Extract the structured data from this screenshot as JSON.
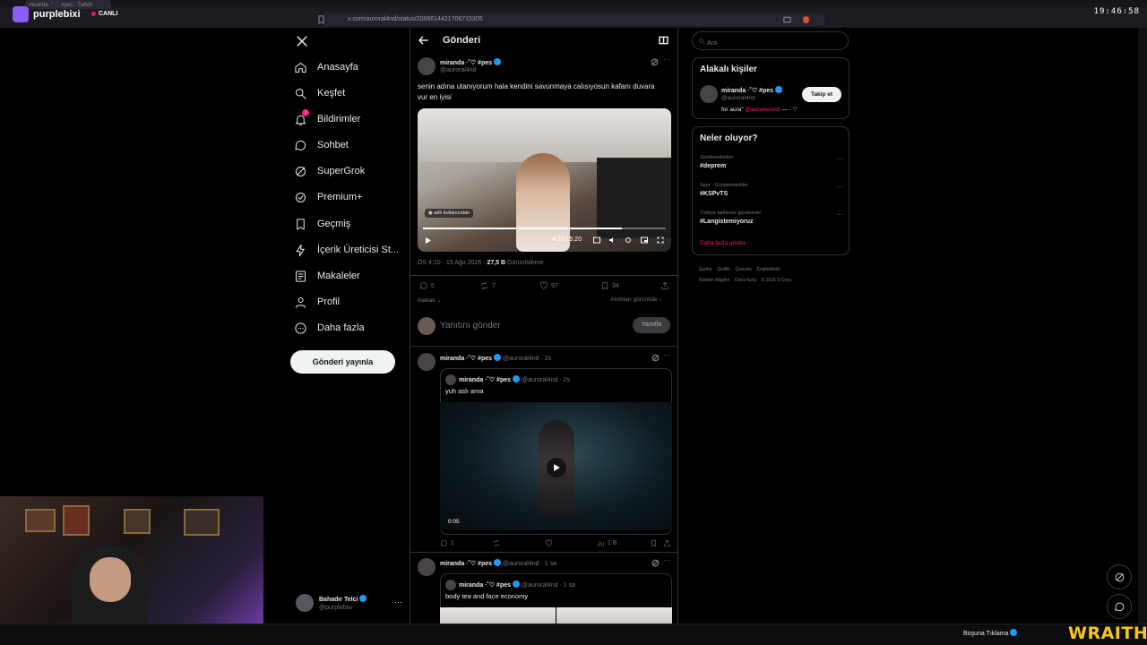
{
  "browser": {
    "tab_title": "miranda ·˚ ♡ #pes - Twitch",
    "brand": "purplebixi",
    "live_label": "CANLI",
    "url": "x.com/auroral4nd/status/2088614421706715305",
    "clock": "19:46:58"
  },
  "nav": {
    "items": [
      {
        "label": "Anasayfa",
        "icon": "home-icon"
      },
      {
        "label": "Keşfet",
        "icon": "search-icon"
      },
      {
        "label": "Bildirimler",
        "icon": "bell-icon",
        "badge": "1"
      },
      {
        "label": "Sohbet",
        "icon": "chat-icon"
      },
      {
        "label": "SuperGrok",
        "icon": "grok-icon"
      },
      {
        "label": "Premium+",
        "icon": "verified-icon"
      },
      {
        "label": "Geçmiş",
        "icon": "bookmark-icon"
      },
      {
        "label": "İçerik Üreticisi St...",
        "icon": "lightning-icon"
      },
      {
        "label": "Makaleler",
        "icon": "article-icon"
      },
      {
        "label": "Profil",
        "icon": "person-icon"
      },
      {
        "label": "Daha fazla",
        "icon": "more-circle-icon"
      }
    ],
    "post_button": "Gönderi yayınla",
    "account": {
      "name": "Bahadır Telci",
      "handle": "@purplebixi"
    }
  },
  "main": {
    "header_title": "Gönderi",
    "tweet": {
      "name": "miranda ·˚♡ #pes",
      "handle": "@auroral4nd",
      "text": "senin adına utanıyorum hala kendini savunmaya calısıyosun kafanı duvara vur en iyisi",
      "video_label": "adlı kullanıcıdan",
      "video_time": "4:25 / 5:20",
      "video_progress": 0.82,
      "time": "ÖS 4:10 · 15 Ağu 2026 ·",
      "views_count": "27,5 B",
      "views_label": "Görüntüleme",
      "replies": "5",
      "retweets": "7",
      "likes": "97",
      "bookmarks": "34",
      "related_label": "Alakalı",
      "quotes_label": "Alıntıları görüntüle"
    },
    "reply_box": {
      "placeholder": "Yanıtını gönder",
      "button": "Yanıtla"
    },
    "replies": [
      {
        "name": "miranda ·˚♡ #pes",
        "handle": "@auroral4nd · 2s",
        "quote": {
          "name": "miranda ·˚♡ #pes",
          "handle": "@auroral4nd · 2s",
          "text": "yuh aslı ama",
          "video_time": "0:05"
        },
        "replies": "1",
        "views": "1 B"
      },
      {
        "name": "miranda ·˚♡ #pes",
        "handle": "@auroral4nd · 1 sa",
        "quote": {
          "name": "miranda ·˚♡ #pes",
          "handle": "@auroral4nd · 1 sa",
          "text": "body tea and face economy"
        }
      }
    ]
  },
  "right": {
    "search_placeholder": "Ara",
    "related": {
      "title": "Alakalı kişiler",
      "name": "miranda ·˚♡ #pes",
      "handle": "@auroral4nd",
      "bio_prefix": "for aura\"",
      "bio_mention": "@aura4world",
      "bio_suffix": "— · ♡",
      "follow": "Takip et"
    },
    "trends": {
      "title": "Neler oluyor?",
      "items": [
        {
          "category": "Gündemdekiler",
          "tag": "#deprem"
        },
        {
          "category": "Spor · Gündemdekiler",
          "tag": "#KSPvTS"
        },
        {
          "category": "Türkiye tarihinde gündemde",
          "tag": "#Langistemiyoruz"
        }
      ],
      "show_more": "Daha fazla göster"
    },
    "footer": [
      "Şartlar",
      "Gizlilik",
      "Çerezler",
      "Erişilebilirlik",
      "Reklam Bilgileri",
      "Daha fazla",
      "© 2026 X Corp."
    ]
  },
  "stream": {
    "bottom_label": "Boşuna Tıklama",
    "sponsor": "WRAITH"
  },
  "colors": {
    "accent": "#1d9bf0",
    "like": "#f91880",
    "twitch": "#9146ff",
    "sponsor": "#f5c518"
  }
}
